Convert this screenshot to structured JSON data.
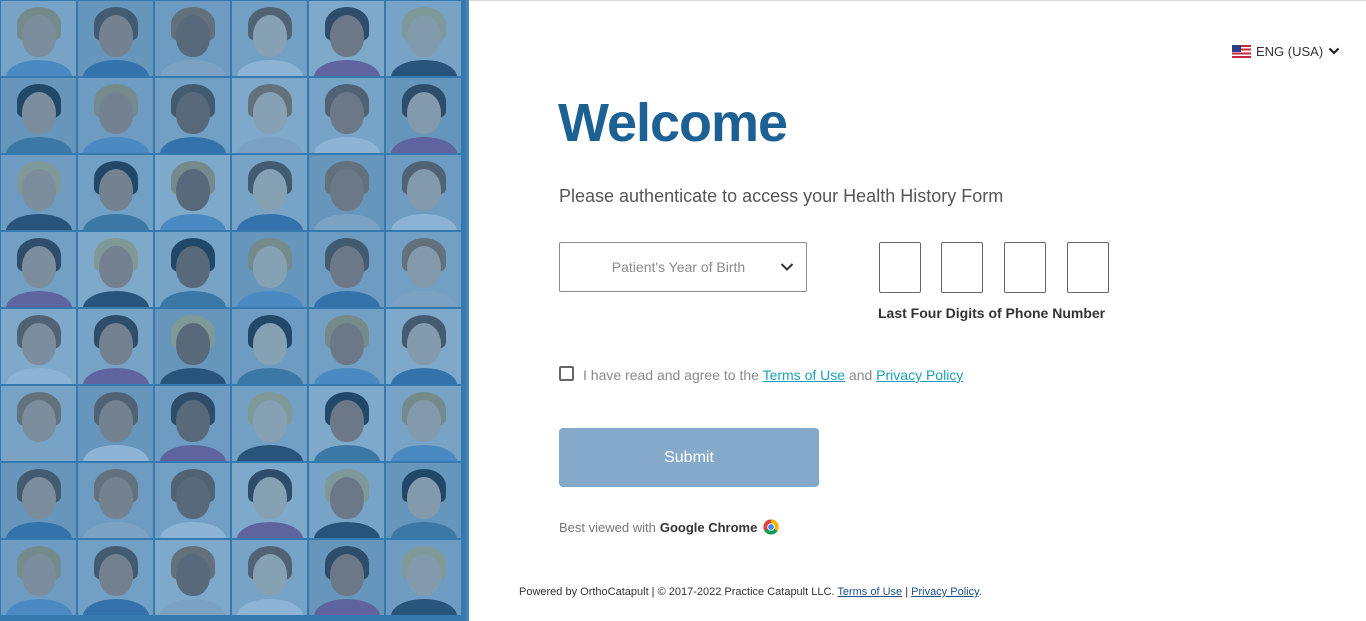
{
  "language": {
    "label": "ENG (USA)",
    "icon": "us-flag-icon"
  },
  "welcome": {
    "title": "Welcome",
    "subtitle": "Please authenticate to access your Health History Form"
  },
  "year_select": {
    "placeholder": "Patient's Year of Birth"
  },
  "phone": {
    "label": "Last Four Digits of Phone Number",
    "digits": [
      "",
      "",
      "",
      ""
    ]
  },
  "agreement": {
    "prefix": "I have read and agree to the",
    "terms_link": "Terms of Use",
    "and": "and",
    "privacy_link": "Privacy Policy"
  },
  "submit": {
    "label": "Submit"
  },
  "best_viewed": {
    "prefix": "Best viewed with",
    "browser": "Google Chrome"
  },
  "footer": {
    "text": "Powered by OrthoCatapult | © 2017-2022 Practice Catapult LLC.",
    "terms_link": "Terms of Use",
    "separator": "|",
    "privacy_link": "Privacy Policy",
    "end": "."
  },
  "colors": {
    "welcome": "#1d6094",
    "submit_bg": "#85aac9",
    "link": "#1aa0b8",
    "mosaic_tint": "#3076b0"
  }
}
